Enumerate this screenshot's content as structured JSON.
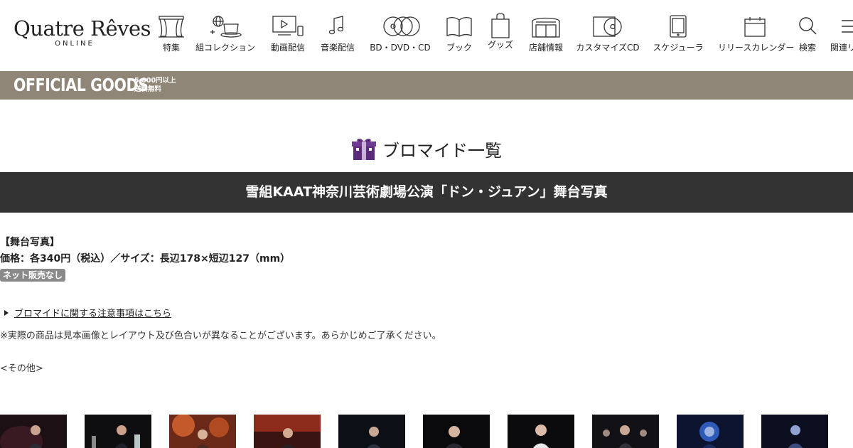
{
  "header": {
    "logo_main": "Quatre Rêves",
    "logo_sub": "ONLINE",
    "nav": [
      {
        "label": "特集",
        "icon": "theater-curtain-icon"
      },
      {
        "label": "組コレクション",
        "icon": "top-hat-globe-icon"
      },
      {
        "label": "動画配信",
        "icon": "video-screen-icon"
      },
      {
        "label": "音楽配信",
        "icon": "music-note-icon"
      },
      {
        "label": "BD・DVD・CD",
        "icon": "discs-icon"
      },
      {
        "label": "ブック",
        "icon": "book-icon"
      },
      {
        "label": "グッズ",
        "icon": "shopping-bag-icon"
      },
      {
        "label": "店舗情報",
        "icon": "store-icon"
      },
      {
        "label": "カスタマイズCD",
        "icon": "cd-case-icon"
      },
      {
        "label": "スケジューラ",
        "icon": "tablet-icon"
      },
      {
        "label": "リリースカレンダー",
        "icon": "calendar-icon"
      },
      {
        "label": "検索",
        "icon": "search-icon"
      },
      {
        "label": "関連リ",
        "icon": "menu-icon"
      }
    ]
  },
  "goods_banner": {
    "title": "OFFICIAL GOODS",
    "note_line1": "5,000円以上",
    "note_line2": "送料無料"
  },
  "page": {
    "heading": "ブロマイド一覧",
    "title": "雪組KAAT神奈川芸術劇場公演「ドン・ジュアン」舞台写真"
  },
  "info": {
    "category": "【舞台写真】",
    "price_size": "価格：各340円（税込）／サイズ：長辺178×短辺127（mm）",
    "badge": "ネット販売なし",
    "notice_link": "ブロマイドに関する注意事項はこちら",
    "disclaimer": "※実際の商品は見本画像とレイアウト及び色合いが異なることがございます。あらかじめご了承ください。",
    "section_other": "<その他>"
  },
  "colors": {
    "goods_bar": "#8f8677",
    "title_bar": "#333333",
    "gift_icon": "#5b2a7a",
    "badge": "#8a8a8a"
  },
  "thumbnails": [
    {
      "name": "stage-photo-1"
    },
    {
      "name": "stage-photo-2"
    },
    {
      "name": "stage-photo-3"
    },
    {
      "name": "stage-photo-4"
    },
    {
      "name": "stage-photo-5"
    },
    {
      "name": "stage-photo-6"
    },
    {
      "name": "stage-photo-7"
    },
    {
      "name": "stage-photo-8"
    },
    {
      "name": "stage-photo-9"
    },
    {
      "name": "stage-photo-10"
    }
  ]
}
